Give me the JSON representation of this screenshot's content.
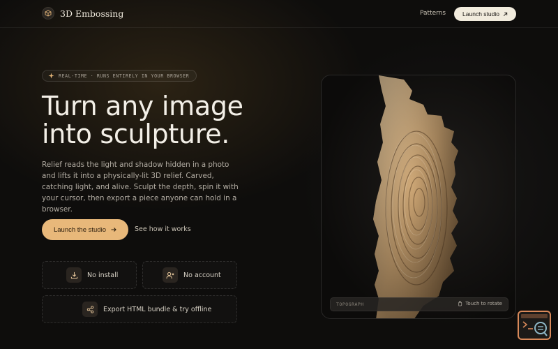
{
  "nav": {
    "brand": "3D Embossing",
    "links": [
      "Patterns"
    ],
    "cta": "Launch studio",
    "cta_icon": "arrow-up-right-icon"
  },
  "hero": {
    "badge": "REAL-TIME · RUNS ENTIRELY IN YOUR BROWSER",
    "headline_line1": "Turn any image",
    "headline_line2": "into sculpture.",
    "description": "Relief reads the light and shadow hidden in a photo and lifts it into a physically-lit 3D relief. Carved, catching light, and alive. Sculpt the depth, spin it with your cursor, then export a piece anyone can hold in a browser.",
    "primary_cta": "Launch the studio",
    "secondary_cta": "See how it works"
  },
  "features": [
    {
      "label": "No install",
      "icon": "download-icon"
    },
    {
      "label": "No account",
      "icon": "user-x-icon"
    },
    {
      "label": "Export HTML bundle & try offline",
      "icon": "share-icon"
    }
  ],
  "viewer": {
    "tag": "TOPOGRAPH",
    "hint": "Touch to rotate",
    "hint_icon": "hand-icon"
  },
  "colors": {
    "accent": "#e8b87a",
    "background": "#0e0d0c",
    "text": "#f3efe7",
    "sculpture": "#c9a271"
  }
}
